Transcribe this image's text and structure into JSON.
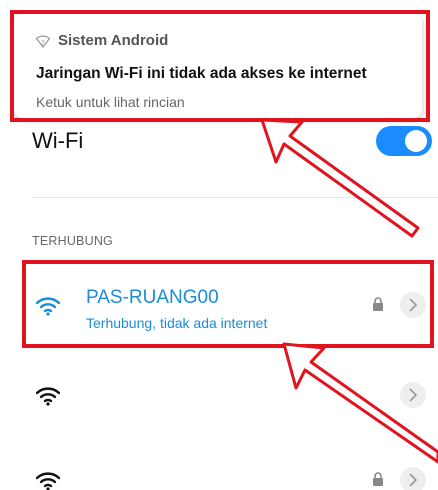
{
  "notification": {
    "app_name": "Sistem Android",
    "title": "Jaringan Wi-Fi ini tidak ada akses ke internet",
    "subtitle": "Ketuk untuk lihat rincian"
  },
  "wifi": {
    "label": "Wi-Fi",
    "enabled": true
  },
  "section": {
    "connected_label": "TERHUBUNG"
  },
  "networks": [
    {
      "name": "PAS-RUANG00",
      "status": "Terhubung, tidak ada internet",
      "secured": true,
      "connected": true
    },
    {
      "name": "",
      "status": "",
      "secured": false,
      "connected": false
    },
    {
      "name": "",
      "status": "",
      "secured": true,
      "connected": false
    }
  ],
  "colors": {
    "accent": "#1a8cd8",
    "toggle_on": "#1a8cff",
    "annotation_red": "#e0141e"
  }
}
